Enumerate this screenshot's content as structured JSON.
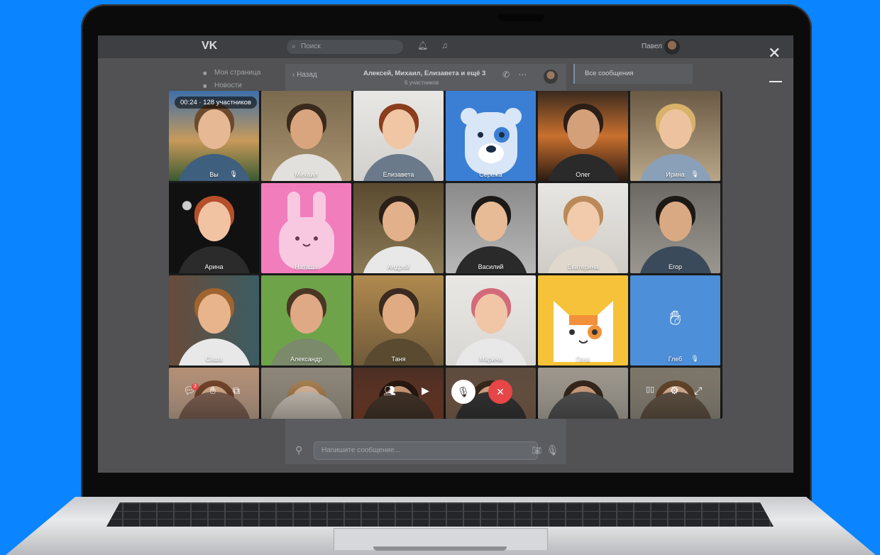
{
  "vk": {
    "logo": "VK",
    "search_placeholder": "Поиск",
    "user_name": "Павел",
    "menu": [
      "Моя страница",
      "Новости"
    ],
    "chat_back": "Назад",
    "chat_title": "Алексей, Михаил, Елизавета и ещё 3",
    "chat_subtitle": "6 участников",
    "right_panel": "Все сообщения",
    "composer_placeholder": "Напишите сообщение..."
  },
  "call": {
    "timer": "00:24 · 128 участников",
    "participants": [
      {
        "name": "Вы",
        "muted": true
      },
      {
        "name": "Михаил"
      },
      {
        "name": "Елизавета"
      },
      {
        "name": "Сережа",
        "speaking": true,
        "avatar": "bear-mask"
      },
      {
        "name": "Олег"
      },
      {
        "name": "Ирина",
        "muted": true
      },
      {
        "name": "Арина"
      },
      {
        "name": "Наташа",
        "avatar": "bunny-mask"
      },
      {
        "name": "Андрей"
      },
      {
        "name": "Василий"
      },
      {
        "name": "Екатерина"
      },
      {
        "name": "Егор"
      },
      {
        "name": "Саша"
      },
      {
        "name": "Александр"
      },
      {
        "name": "Таня"
      },
      {
        "name": "Марина"
      },
      {
        "name": "Гена",
        "avatar": "cat-mask"
      },
      {
        "name": "Глеб",
        "muted": true,
        "raised_hand": true
      },
      {
        "name": ""
      },
      {
        "name": ""
      },
      {
        "name": ""
      },
      {
        "name": ""
      },
      {
        "name": ""
      },
      {
        "name": ""
      }
    ],
    "chat_badge": "3",
    "colors": {
      "speaking": "#4bb34b",
      "end_call": "#e64646",
      "accent": "#0a84ff"
    }
  }
}
